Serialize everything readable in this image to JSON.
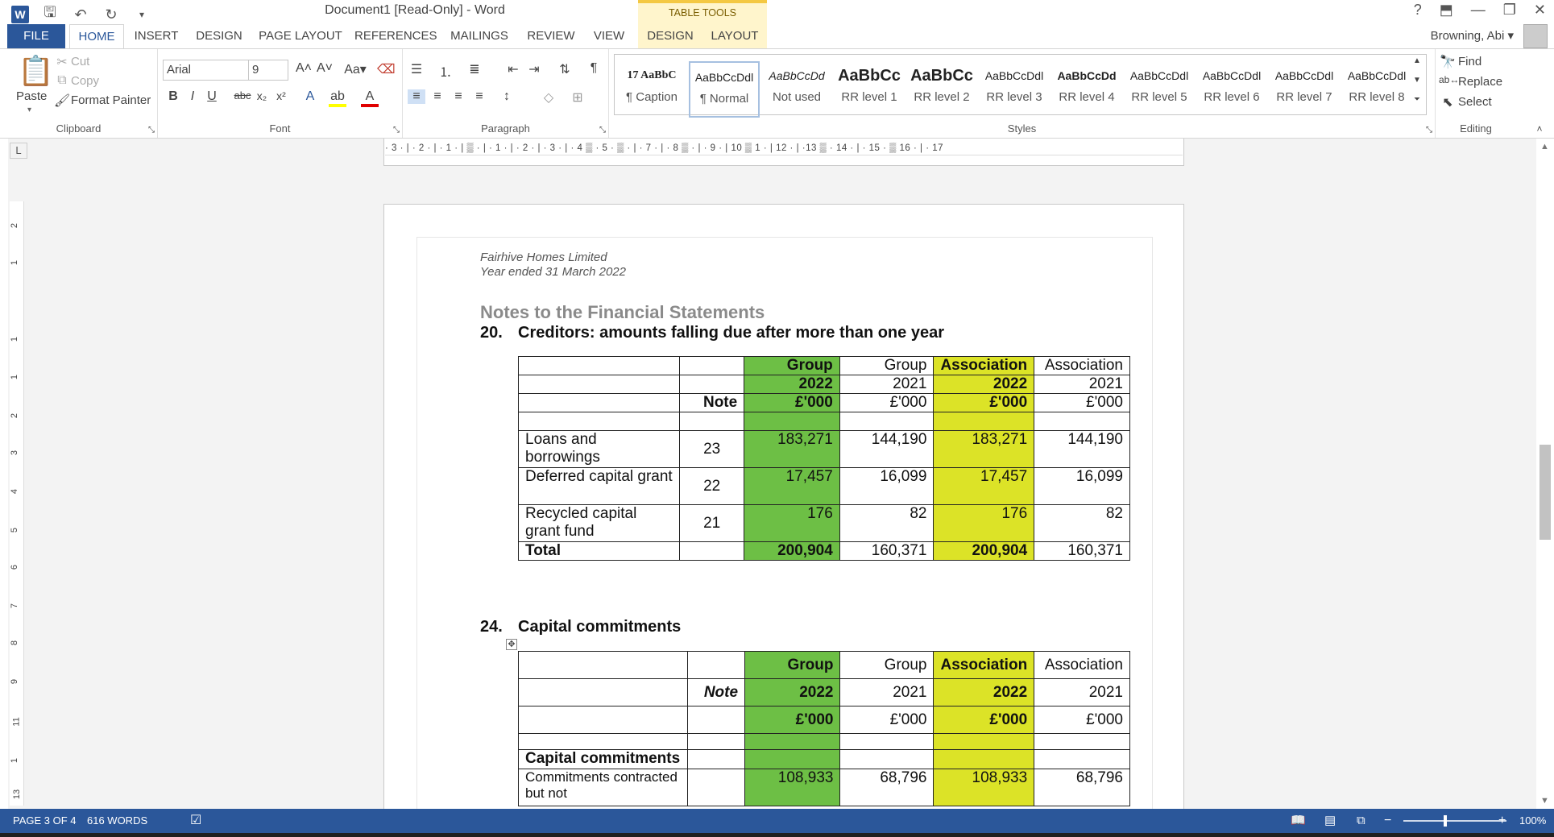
{
  "window": {
    "title": "Document1 [Read-Only] - Word",
    "table_tools": "TABLE TOOLS",
    "user": "Browning, Abi ▾"
  },
  "tabs": [
    "FILE",
    "HOME",
    "INSERT",
    "DESIGN",
    "PAGE LAYOUT",
    "REFERENCES",
    "MAILINGS",
    "REVIEW",
    "VIEW",
    "DESIGN",
    "LAYOUT"
  ],
  "ribbon": {
    "clipboard": {
      "label": "Clipboard",
      "paste": "Paste",
      "cut": "Cut",
      "copy": "Copy",
      "format_painter": "Format Painter"
    },
    "font": {
      "label": "Font",
      "name": "Arial",
      "size": "9"
    },
    "paragraph": {
      "label": "Paragraph"
    },
    "styles": {
      "label": "Styles",
      "items": [
        {
          "sample": "17 AaBbC",
          "name": "¶ Caption"
        },
        {
          "sample": "AaBbCcDdl",
          "name": "¶ Normal"
        },
        {
          "sample": "AaBbCcDd",
          "name": "Not used"
        },
        {
          "sample": "AaBbCc",
          "name": "RR level 1"
        },
        {
          "sample": "AaBbCc",
          "name": "RR level 2"
        },
        {
          "sample": "AaBbCcDdl",
          "name": "RR level 3"
        },
        {
          "sample": "AaBbCcDd",
          "name": "RR level 4"
        },
        {
          "sample": "AaBbCcDdl",
          "name": "RR level 5"
        },
        {
          "sample": "AaBbCcDdl",
          "name": "RR level 6"
        },
        {
          "sample": "AaBbCcDdl",
          "name": "RR level 7"
        },
        {
          "sample": "AaBbCcDdl",
          "name": "RR level 8"
        }
      ]
    },
    "editing": {
      "label": "Editing",
      "find": "Find",
      "replace": "Replace",
      "select": "Select"
    }
  },
  "ruler": {
    "horizontal": "· 3 · | · 2 · | · 1 · | ▒ · | · 1 · | · 2 · | · 3 · | · 4 ▒ · 5 · ▒ · | · 7 · | · 8 ▒ · | · 9 · | 10 ▒ 1 · | 12 · | ·13 ▒ · 14 · | · 15 · ▒ 16 · | · 17",
    "vertical_numbers": [
      "2",
      "1",
      "1",
      "1",
      "2",
      "3",
      "4",
      "5",
      "6",
      "7",
      "8",
      "9",
      "11",
      "1",
      "13"
    ]
  },
  "document": {
    "company": "Fairhive Homes Limited",
    "period": "Year ended 31 March 2022",
    "notes_title": "Notes to the Financial Statements",
    "section20": {
      "number": "20.",
      "title": "Creditors: amounts falling due after more than one year",
      "header": {
        "group_cur": "Group",
        "group_prev": "Group",
        "assoc_cur": "Association",
        "assoc_prev": "Association",
        "y_cur_g": "2022",
        "y_prev_g": "2021",
        "y_cur_a": "2022",
        "y_prev_a": "2021",
        "note": "Note",
        "u1": "£'000",
        "u2": "£'000",
        "u3": "£'000",
        "u4": "£'000"
      },
      "rows": [
        {
          "label": "Loans and borrowings",
          "note": "23",
          "g22": "183,271",
          "g21": "144,190",
          "a22": "183,271",
          "a21": "144,190"
        },
        {
          "label": "Deferred capital grant",
          "note": "22",
          "g22": "17,457",
          "g21": "16,099",
          "a22": "17,457",
          "a21": "16,099"
        },
        {
          "label": "Recycled capital grant fund",
          "note": "21",
          "g22": "176",
          "g21": "82",
          "a22": "176",
          "a21": "82"
        }
      ],
      "total": {
        "label": "Total",
        "g22": "200,904",
        "g21": "160,371",
        "a22": "200,904",
        "a21": "160,371"
      }
    },
    "section24": {
      "number": "24.",
      "title": "Capital commitments",
      "header": {
        "group_cur": "Group",
        "group_prev": "Group",
        "assoc_cur": "Association",
        "assoc_prev": "Association",
        "note": "Note",
        "y_cur_g": "2022",
        "y_prev_g": "2021",
        "y_cur_a": "2022",
        "y_prev_a": "2021",
        "u1": "£'000",
        "u2": "£'000",
        "u3": "£'000",
        "u4": "£'000"
      },
      "subheading": "Capital commitments",
      "row": {
        "label": "Commitments contracted but not",
        "g22": "108,933",
        "g21": "68,796",
        "a22": "108,933",
        "a21": "68,796"
      }
    }
  },
  "status": {
    "page": "PAGE 3 OF 4",
    "words": "616 WORDS",
    "zoom": "100%"
  },
  "colors": {
    "accent": "#2b579a",
    "group_highlight": "#6dbf45",
    "association_highlight": "#dce327"
  }
}
